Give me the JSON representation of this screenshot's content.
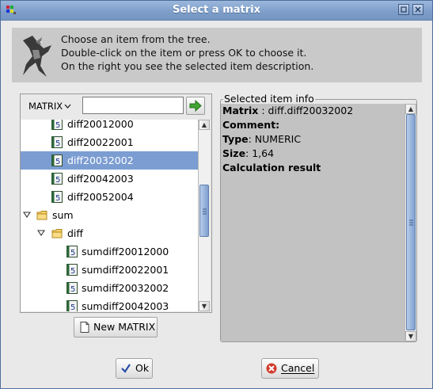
{
  "window": {
    "title": "Select a matrix"
  },
  "banner": {
    "line1": "Choose an item from the tree.",
    "line2": "Double-click on the item or press OK to choose it.",
    "line3": "On the right you see the selected item description."
  },
  "left_panel": {
    "combo_label": "MATRIX",
    "search_value": "",
    "new_button_label": "New MATRIX"
  },
  "tree": {
    "items": [
      {
        "label": "diff20012000",
        "type": "matrix"
      },
      {
        "label": "diff20022001",
        "type": "matrix"
      },
      {
        "label": "diff20032002",
        "type": "matrix",
        "selected": true
      },
      {
        "label": "diff20042003",
        "type": "matrix"
      },
      {
        "label": "diff20052004",
        "type": "matrix"
      },
      {
        "label": "sum",
        "type": "folder",
        "expanded": true
      },
      {
        "label": "diff",
        "type": "folder",
        "expanded": true
      },
      {
        "label": "sumdiff20012000",
        "type": "matrix"
      },
      {
        "label": "sumdiff20022001",
        "type": "matrix"
      },
      {
        "label": "sumdiff20032002",
        "type": "matrix"
      },
      {
        "label": "sumdiff20042003",
        "type": "matrix"
      }
    ]
  },
  "info": {
    "legend": "Selected item info",
    "matrix_key": "Matrix",
    "matrix_value": " : diff.diff20032002",
    "comment_key": "Comment",
    "comment_value": ":",
    "type_key": "Type",
    "type_value": ": NUMERIC",
    "size_key": "Size",
    "size_value": ": 1,64",
    "calc": "Calculation result"
  },
  "buttons": {
    "ok": "Ok",
    "cancel": "Cancel"
  },
  "colors": {
    "selection": "#7b9dd2",
    "title_bar": "#8aa8d0",
    "scroll_thumb": "#8faad4"
  }
}
